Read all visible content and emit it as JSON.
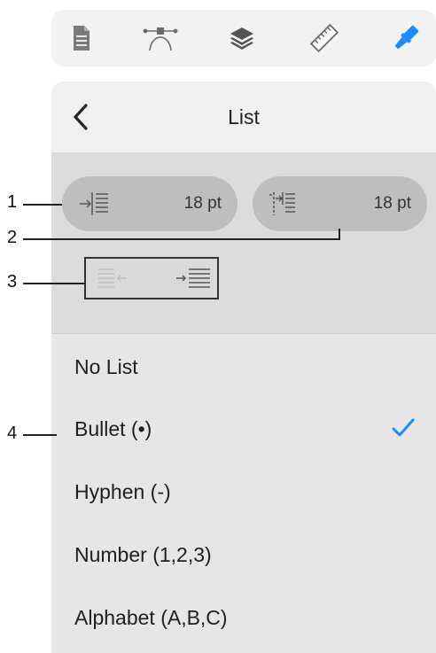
{
  "toolbar": {
    "items": [
      {
        "icon": "document-icon"
      },
      {
        "icon": "bezier-pen-icon"
      },
      {
        "icon": "layers-icon"
      },
      {
        "icon": "ruler-icon"
      },
      {
        "icon": "brush-icon",
        "selected": true,
        "color": "#1a8cff"
      }
    ]
  },
  "panel": {
    "title": "List",
    "back_icon": "chevron-left-icon"
  },
  "indent": {
    "left_value": "18 pt",
    "right_value": "18 pt"
  },
  "callouts": {
    "c1": "1",
    "c2": "2",
    "c3": "3",
    "c4": "4"
  },
  "list_options": [
    {
      "label": "No List",
      "selected": false
    },
    {
      "label": "Bullet (•)",
      "selected": true
    },
    {
      "label": "Hyphen (-)",
      "selected": false
    },
    {
      "label": "Number (1,2,3)",
      "selected": false
    },
    {
      "label": "Alphabet (A,B,C)",
      "selected": false
    }
  ],
  "colors": {
    "accent": "#1a8cff",
    "panel_bg": "#e6e6e6",
    "pill_bg": "#bebebe"
  }
}
